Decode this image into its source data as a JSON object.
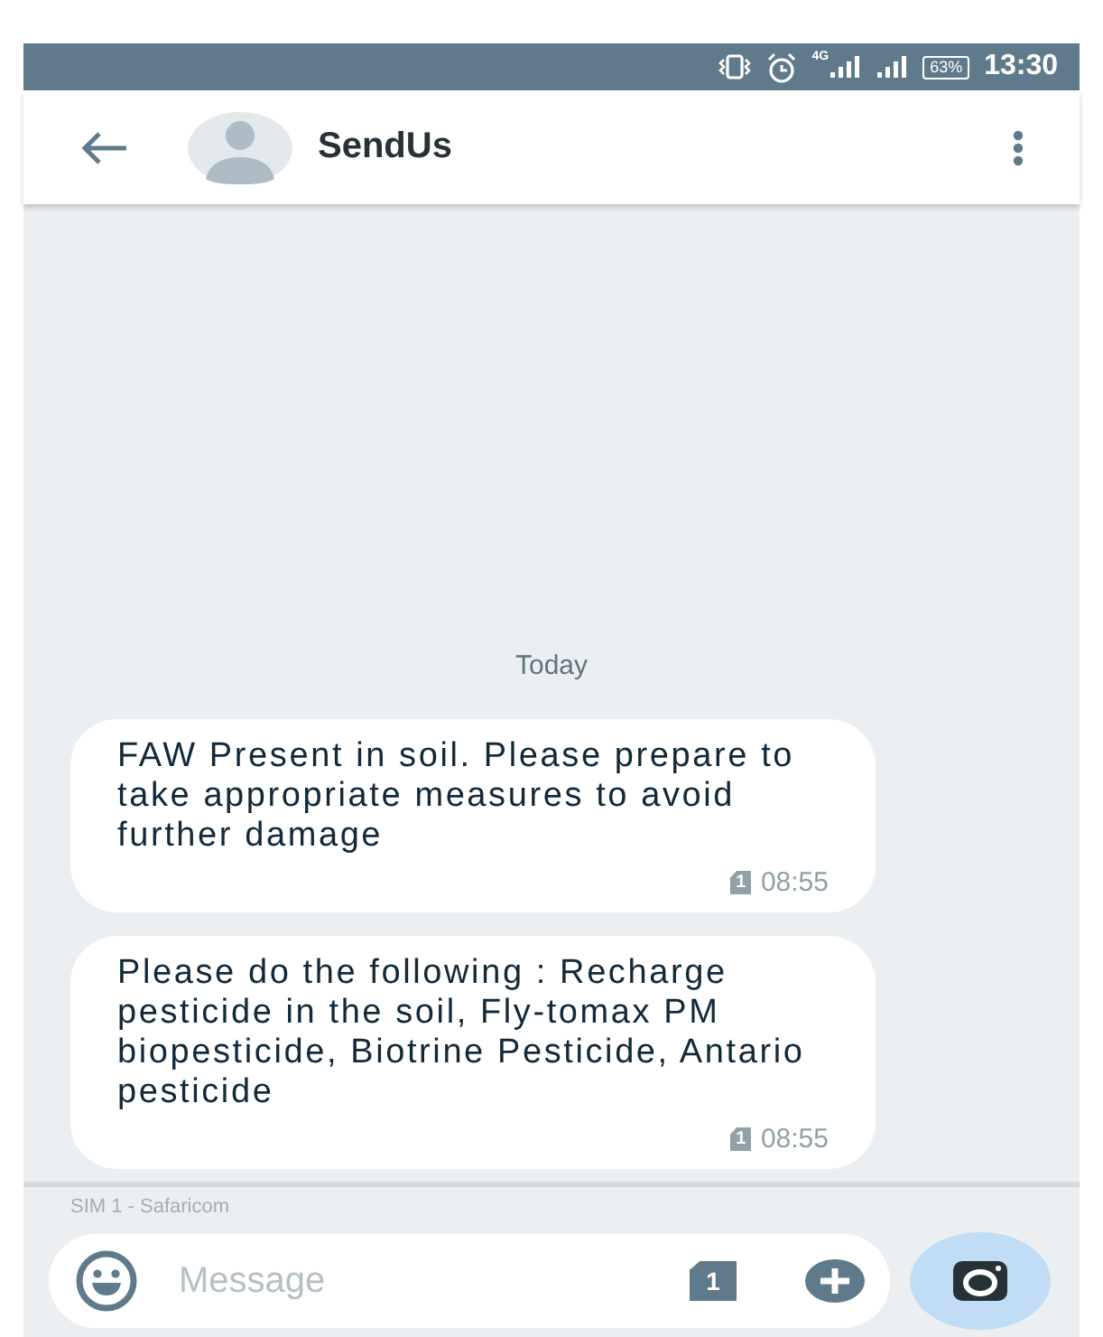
{
  "status_bar": {
    "network": "4G",
    "battery": "63%",
    "time": "13:30"
  },
  "header": {
    "title": "SendUs"
  },
  "date_divider": "Today",
  "messages": [
    {
      "text": "FAW Present in soil. Please prepare to take appropriate measures to avoid further damage",
      "sim": "1",
      "time": "08:55"
    },
    {
      "text": "Please do the following : Recharge pesticide in the soil, Fly-tomax PM biopesticide, Biotrine Pesticide, Antario pesticide",
      "sim": "1",
      "time": "08:55"
    }
  ],
  "compose": {
    "sim_label": "SIM 1 - Safaricom",
    "placeholder": "Message",
    "sim_button": "1"
  }
}
